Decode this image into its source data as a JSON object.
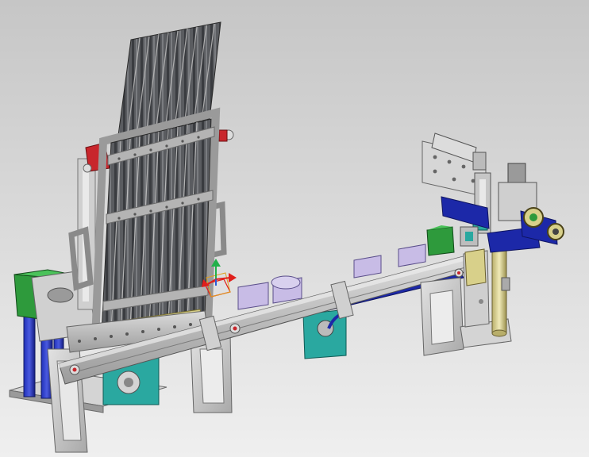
{
  "scene": {
    "kind": "cad-model-render",
    "colors": {
      "background_top": "#c7c7c7",
      "background_bottom": "#efefef",
      "frame": "#c9c9c9",
      "frame_dark": "#8e8e8e",
      "slot_dark": "#4d4f53",
      "green": "#2e9a3c",
      "blue": "#1c28a8",
      "teal": "#2aa8a0",
      "lavender": "#c8bce6",
      "red": "#c8262c",
      "yellow": "#d8d08a",
      "triad_x": "#e0201c",
      "triad_y": "#22b04a",
      "triad_z": "#2a5ad8"
    }
  }
}
